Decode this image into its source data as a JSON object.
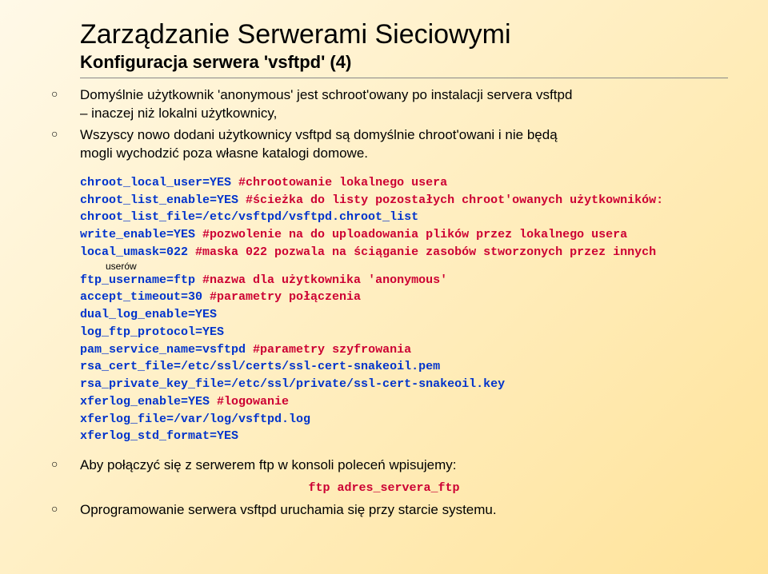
{
  "title": "Zarządzanie Serwerami Sieciowymi",
  "subtitle": "Konfiguracja serwera 'vsftpd' (4)",
  "bullet1a": "Domyślnie użytkownik 'anonymous' jest schroot'owany po instalacji servera vsftpd",
  "bullet1b": "– inaczej niż lokalni użytkownicy,",
  "bullet2a": "Wszyscy nowo dodani użytkownicy vsftpd są domyślnie chroot'owani i nie będą",
  "bullet2b": "mogli wychodzić poza własne katalogi domowe.",
  "cfg": {
    "l1a": "chroot_local_user=YES ",
    "l1b": "#chrootowanie lokalnego usera",
    "l2a": "chroot_list_enable=YES ",
    "l2b": "#ścieżka do listy pozostałych chroot'owanych użytkowników:",
    "l3": "chroot_list_file=/etc/vsftpd/vsftpd.chroot_list",
    "l4a": "write_enable=YES ",
    "l4b": "#pozwolenie na do uploadowania plików przez lokalnego usera",
    "l5a": "local_umask=022 ",
    "l5b": "#maska 022 pozwala na ściąganie zasobów stworzonych przez innych",
    "l5c": "userów",
    "l6a": "ftp_username=ftp ",
    "l6b": "#nazwa dla użytkownika 'anonymous'",
    "l7a": "accept_timeout=30 ",
    "l7b": "#parametry połączenia",
    "l8": "dual_log_enable=YES",
    "l9": "log_ftp_protocol=YES",
    "l10a": "pam_service_name=vsftpd ",
    "l10b": "#parametry szyfrowania",
    "l11": "rsa_cert_file=/etc/ssl/certs/ssl-cert-snakeoil.pem",
    "l12": "rsa_private_key_file=/etc/ssl/private/ssl-cert-snakeoil.key",
    "l13a": "xferlog_enable=YES ",
    "l13b": "#logowanie",
    "l14": "xferlog_file=/var/log/vsftpd.log",
    "l15": "xferlog_std_format=YES"
  },
  "bullet3": "Aby połączyć się z serwerem ftp w konsoli poleceń wpisujemy:",
  "ftpcmd": "ftp adres_servera_ftp",
  "bullet4": "Oprogramowanie serwera vsftpd uruchamia się przy starcie systemu."
}
